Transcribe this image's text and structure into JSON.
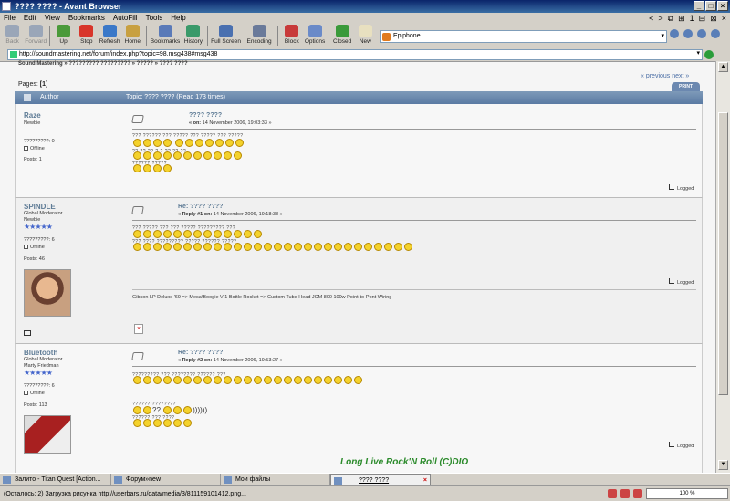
{
  "window": {
    "title": "???? ???? - Avant Browser",
    "controls": [
      "_",
      "□",
      "×"
    ]
  },
  "menubar": {
    "items": [
      "File",
      "Edit",
      "View",
      "Bookmarks",
      "AutoFill",
      "Tools",
      "Help"
    ],
    "right_glyphs": [
      "<",
      ">",
      "⧉",
      "⊞",
      "1",
      "⊟",
      "⊠",
      "×"
    ]
  },
  "toolbar": {
    "buttons": [
      {
        "label": "Back",
        "icon": "back-arrow-icon",
        "color": "#9aa6b8",
        "disabled": true
      },
      {
        "label": "Forward",
        "icon": "forward-arrow-icon",
        "color": "#9aa6b8",
        "disabled": true
      },
      {
        "label": "Up",
        "icon": "up-arrow-icon",
        "color": "#4a9a3a"
      },
      {
        "label": "Stop",
        "icon": "stop-icon",
        "color": "#d8352a"
      },
      {
        "label": "Refresh",
        "icon": "refresh-icon",
        "color": "#3a78c8"
      },
      {
        "label": "Home",
        "icon": "home-icon",
        "color": "#c8a040"
      },
      {
        "label": "Bookmarks",
        "icon": "bookmarks-icon",
        "color": "#5a7ab8"
      },
      {
        "label": "History",
        "icon": "history-icon",
        "color": "#3a9a6a"
      },
      {
        "label": "Full Screen",
        "icon": "full-screen-icon",
        "color": "#4a70b0"
      },
      {
        "label": "Encoding",
        "icon": "encoding-icon",
        "color": "#6a7a9a"
      },
      {
        "label": "Block",
        "icon": "block-icon",
        "color": "#c83a3a"
      },
      {
        "label": "Options",
        "icon": "options-icon",
        "color": "#6a8ac8"
      },
      {
        "label": "Closed",
        "icon": "closed-icon",
        "color": "#3a9a3a"
      },
      {
        "label": "New",
        "icon": "new-icon",
        "color": "#e8e0c0"
      }
    ]
  },
  "search": {
    "value": "Epiphone"
  },
  "address": {
    "url": "http://soundmastering.net/forum/index.php?topic=98.msg438#msg438"
  },
  "page": {
    "breadcrumb": "Sound Mastering » ????????? ????????? » ????? » ???? ????",
    "prevnext": "« previous next »",
    "pages_label": "Pages: ",
    "pages_current": "[1]",
    "print_label": "PRINT",
    "header_author": "Author",
    "header_topic": "Topic: ???? ????  (Read 173 times)"
  },
  "posts": [
    {
      "name": "Raze",
      "rank": "Newbie",
      "stat": "?????????: 0",
      "online": "Offline",
      "posts": "Posts: 1",
      "title": "???? ????",
      "date_prefix": "« on: ",
      "date": "14 November 2006, 19:03:33 »",
      "logged": "Logged",
      "lines": [
        "??? ?????? ???  ????? ??? ????? ???  ?????",
        "?? ?? ?? ? ? ?? ?? ??",
        "?????? ?????"
      ]
    },
    {
      "name": "SPINDLE",
      "rank": "Global Moderator",
      "rank2": "Newbie",
      "stat": "?????????: 6",
      "online": "Offline",
      "posts": "Posts: 46",
      "title": "Re: ???? ????",
      "date_prefix": "« Reply #1 on: ",
      "date": "14 November 2006, 19:18:38 »",
      "logged": "Logged",
      "signature": "Gibson LP Deluxe '69 => Mesa\\Boogie V-1 Bottle Rocket => Custom Tube Head  JCM 800  100w Point-to-Pont Wiring",
      "lines": [
        "???  ?????  ??? ??? ?????  ????????? ???",
        "??? ???? ????????? ????? ?????? ?????"
      ]
    },
    {
      "name": "Bluetooth",
      "rank": "Global Moderator",
      "rank2": "Marty Friedman",
      "stat": "?????????: 6",
      "online": "Offline",
      "posts": "Posts: 113",
      "title": "Re: ???? ????",
      "date_prefix": "« Reply #2 on: ",
      "date": "14 November 2006, 19:53:27 »",
      "logged": "Logged",
      "signature": "Long Live Rock'N Roll (C)DIO",
      "lines": [
        "????????? ???  ????????  ?????? ???",
        "?????? ????????",
        "?????? ???  ????"
      ]
    }
  ],
  "tabs": [
    {
      "label": "Залито - Titan Quest [Action..."
    },
    {
      "label": "Форум»new"
    },
    {
      "label": "Мои файлы"
    },
    {
      "label": "???? ????",
      "active": true
    }
  ],
  "status": {
    "text": "(Осталось: 2) Загрузка рисунка http://userbars.ru/data/media/3/811159101412.png...",
    "zoom": "100 %"
  }
}
